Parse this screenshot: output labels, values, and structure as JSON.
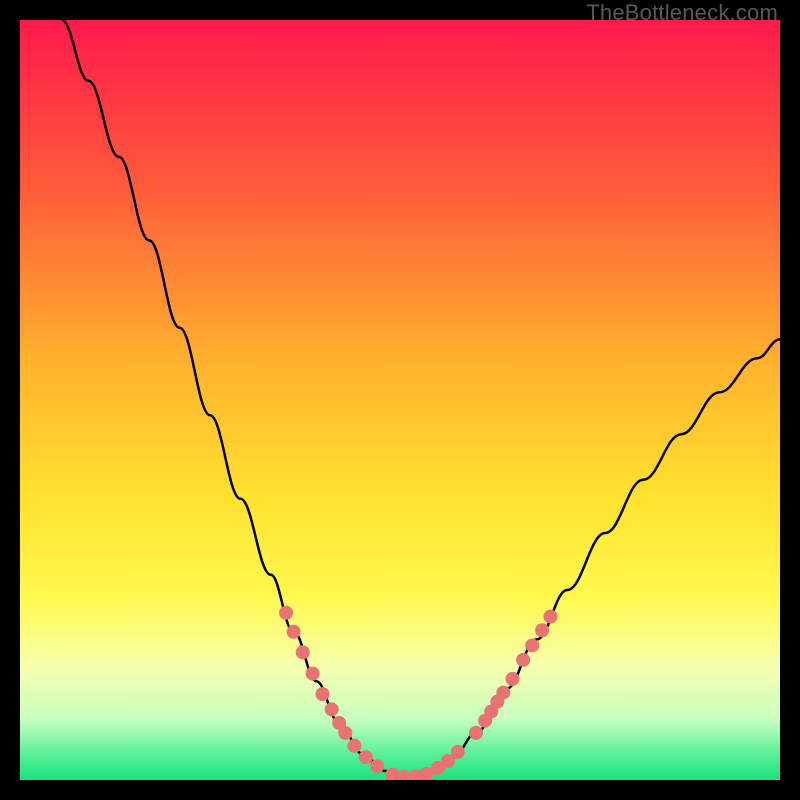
{
  "watermark": "TheBottleneck.com",
  "chart_data": {
    "type": "line",
    "title": "",
    "xlabel": "",
    "ylabel": "",
    "xlim": [
      0,
      1
    ],
    "ylim": [
      0,
      1
    ],
    "background_gradient": {
      "stops": [
        {
          "offset": 0.0,
          "color": "#ff1a4b"
        },
        {
          "offset": 0.22,
          "color": "#ff5b3a"
        },
        {
          "offset": 0.45,
          "color": "#ffb22e"
        },
        {
          "offset": 0.63,
          "color": "#ffe22e"
        },
        {
          "offset": 0.76,
          "color": "#fff94f"
        },
        {
          "offset": 0.85,
          "color": "#f6ffad"
        },
        {
          "offset": 0.92,
          "color": "#c8ffc0"
        },
        {
          "offset": 0.965,
          "color": "#5cf09a"
        },
        {
          "offset": 1.0,
          "color": "#17e27d"
        }
      ]
    },
    "series": [
      {
        "name": "bottleneck-curve",
        "color": "#000000",
        "points": [
          {
            "x": 0.055,
            "y": 1.0
          },
          {
            "x": 0.09,
            "y": 0.92
          },
          {
            "x": 0.13,
            "y": 0.82
          },
          {
            "x": 0.17,
            "y": 0.71
          },
          {
            "x": 0.21,
            "y": 0.595
          },
          {
            "x": 0.25,
            "y": 0.48
          },
          {
            "x": 0.29,
            "y": 0.37
          },
          {
            "x": 0.33,
            "y": 0.27
          },
          {
            "x": 0.36,
            "y": 0.195
          },
          {
            "x": 0.39,
            "y": 0.13
          },
          {
            "x": 0.42,
            "y": 0.075
          },
          {
            "x": 0.45,
            "y": 0.035
          },
          {
            "x": 0.48,
            "y": 0.012
          },
          {
            "x": 0.51,
            "y": 0.004
          },
          {
            "x": 0.54,
            "y": 0.01
          },
          {
            "x": 0.57,
            "y": 0.03
          },
          {
            "x": 0.6,
            "y": 0.062
          },
          {
            "x": 0.64,
            "y": 0.12
          },
          {
            "x": 0.68,
            "y": 0.185
          },
          {
            "x": 0.72,
            "y": 0.25
          },
          {
            "x": 0.77,
            "y": 0.325
          },
          {
            "x": 0.82,
            "y": 0.395
          },
          {
            "x": 0.87,
            "y": 0.455
          },
          {
            "x": 0.92,
            "y": 0.51
          },
          {
            "x": 0.97,
            "y": 0.555
          },
          {
            "x": 1.0,
            "y": 0.58
          }
        ]
      }
    ],
    "scatter": {
      "name": "marker-dots",
      "color": "#e97373",
      "radius": 7,
      "points": [
        {
          "x": 0.35,
          "y": 0.22
        },
        {
          "x": 0.36,
          "y": 0.195
        },
        {
          "x": 0.372,
          "y": 0.168
        },
        {
          "x": 0.385,
          "y": 0.14
        },
        {
          "x": 0.398,
          "y": 0.113
        },
        {
          "x": 0.41,
          "y": 0.093
        },
        {
          "x": 0.42,
          "y": 0.075
        },
        {
          "x": 0.428,
          "y": 0.062
        },
        {
          "x": 0.44,
          "y": 0.045
        },
        {
          "x": 0.455,
          "y": 0.03
        },
        {
          "x": 0.47,
          "y": 0.018
        },
        {
          "x": 0.49,
          "y": 0.007
        },
        {
          "x": 0.505,
          "y": 0.004
        },
        {
          "x": 0.52,
          "y": 0.005
        },
        {
          "x": 0.535,
          "y": 0.008
        },
        {
          "x": 0.55,
          "y": 0.016
        },
        {
          "x": 0.563,
          "y": 0.025
        },
        {
          "x": 0.576,
          "y": 0.037
        },
        {
          "x": 0.6,
          "y": 0.062
        },
        {
          "x": 0.612,
          "y": 0.078
        },
        {
          "x": 0.62,
          "y": 0.09
        },
        {
          "x": 0.628,
          "y": 0.103
        },
        {
          "x": 0.636,
          "y": 0.115
        },
        {
          "x": 0.648,
          "y": 0.133
        },
        {
          "x": 0.662,
          "y": 0.158
        },
        {
          "x": 0.674,
          "y": 0.177
        },
        {
          "x": 0.687,
          "y": 0.197
        },
        {
          "x": 0.698,
          "y": 0.215
        }
      ]
    }
  }
}
